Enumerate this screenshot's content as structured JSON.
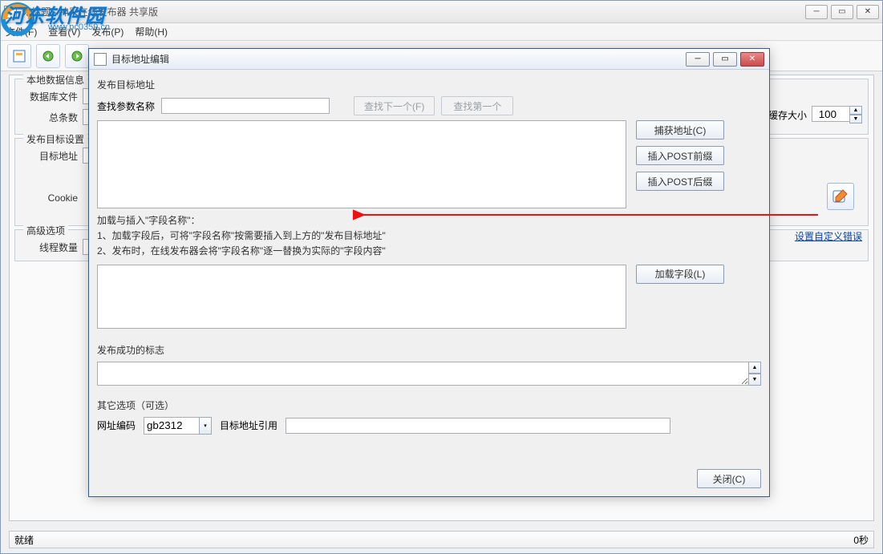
{
  "main": {
    "title": "无标题 - 神采在线发布器 共享版",
    "menu": {
      "file": "文件(F)",
      "view": "查看(V)",
      "publish": "发布(P)",
      "help": "帮助(H)"
    },
    "status_left": "就绪",
    "status_right": "0秒"
  },
  "bg": {
    "group_local": "本地数据信息",
    "db_file": "数据库文件",
    "total": "总条数",
    "group_target": "发布目标设置",
    "target_addr": "目标地址",
    "cookie": "Cookie",
    "group_adv": "高级选项",
    "threads": "线程数量",
    "cache_size": "缓存大小",
    "cache_value": "100",
    "custom_error": "设置自定义错误"
  },
  "dialog": {
    "title": "目标地址编辑",
    "section_publish": "发布目标地址",
    "search_param": "查找参数名称",
    "find_next": "查找下一个(F)",
    "find_first": "查找第一个",
    "capture": "捕获地址(C)",
    "insert_prefix": "插入POST前缀",
    "insert_suffix": "插入POST后缀",
    "note_title": "加载与插入\"字段名称\"：",
    "note_1": "1、加载字段后，可将\"字段名称\"按需要插入到上方的\"发布目标地址\"",
    "note_2": "2、发布时，在线发布器会将\"字段名称\"逐一替换为实际的\"字段内容\"",
    "load_fields": "加载字段(L)",
    "success_label": "发布成功的标志",
    "other_label": "其它选项（可选）",
    "url_encoding": "网址编码",
    "encoding_value": "gb2312",
    "target_ref": "目标地址引用",
    "close": "关闭(C)"
  },
  "watermark": {
    "text": "河东软件园",
    "url": "www.pc0359.cn"
  }
}
